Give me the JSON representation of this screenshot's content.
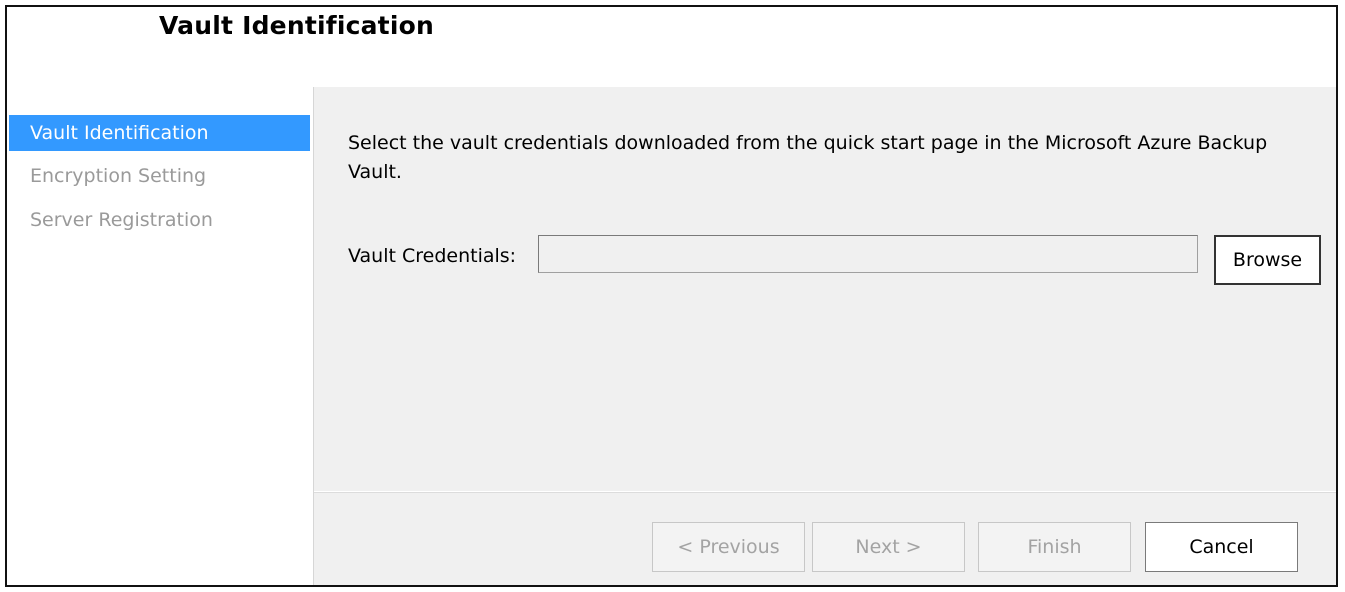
{
  "header": {
    "title": "Vault Identification"
  },
  "sidebar": {
    "items": [
      {
        "label": "Vault Identification",
        "state": "active"
      },
      {
        "label": "Encryption Setting",
        "state": "inactive"
      },
      {
        "label": "Server Registration",
        "state": "inactive"
      }
    ]
  },
  "main": {
    "instructions": "Select the vault credentials downloaded from the quick start page in the Microsoft Azure Backup Vault.",
    "credentials_label": "Vault Credentials:",
    "credentials_value": "",
    "browse_label": "Browse"
  },
  "footer": {
    "previous_label": "< Previous",
    "next_label": "Next >",
    "finish_label": "Finish",
    "cancel_label": "Cancel"
  },
  "colors": {
    "accent": "#3399ff",
    "panel_bg": "#f0f0f0",
    "disabled_text": "#a3a3a3"
  }
}
